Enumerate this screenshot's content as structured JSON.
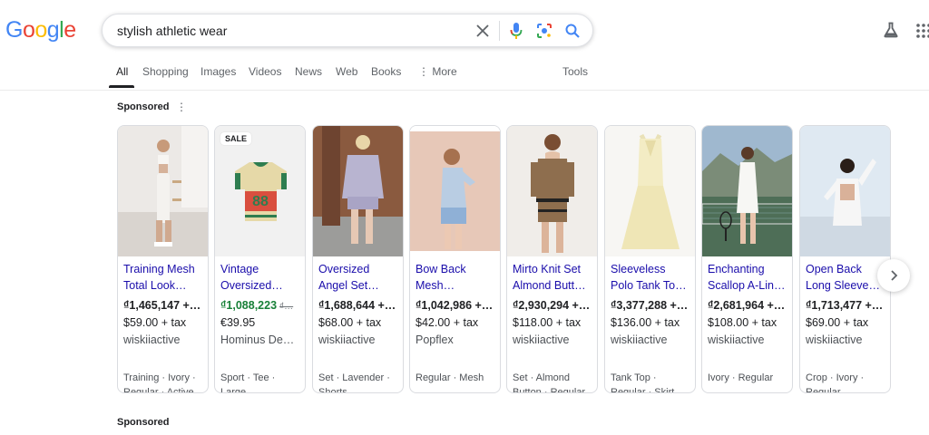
{
  "logo": {
    "letters": [
      "G",
      "o",
      "o",
      "g",
      "l",
      "e"
    ],
    "colors": [
      "#4285F4",
      "#EA4335",
      "#FBBC05",
      "#4285F4",
      "#34A853",
      "#EA4335"
    ]
  },
  "search": {
    "query": "stylish athletic wear"
  },
  "tabs": [
    "All",
    "Shopping",
    "Images",
    "Videos",
    "News",
    "Web",
    "Books",
    "More",
    "Tools"
  ],
  "sponsored": {
    "label": "Sponsored",
    "label_2": "Sponsored"
  },
  "products": [
    {
      "title_1": "Training Mesh",
      "title_2": "Total Look…",
      "price": "₫1,465,147 +…",
      "usd": "$59.00 + tax",
      "seller": "wiskiiactive",
      "tags_1": "Training · Ivory ·",
      "tags_2": "Regular · Active"
    },
    {
      "title_1": "Vintage",
      "title_2": "Oversized…",
      "price": "₫1,088,223",
      "orig_price": "₫…",
      "usd": "€39.95",
      "seller": "Hominus De…",
      "tags_1": "Sport · Tee ·",
      "tags_2": "Large",
      "badge": "SALE"
    },
    {
      "title_1": "Oversized",
      "title_2": "Angel Set…",
      "price": "₫1,688,644 +…",
      "usd": "$68.00 + tax",
      "seller": "wiskiiactive",
      "tags_1": "Set · Lavender ·",
      "tags_2": "Shorts"
    },
    {
      "title_1": "Bow Back",
      "title_2": "Mesh…",
      "price": "₫1,042,986 +…",
      "usd": "$42.00 + tax",
      "seller": "Popflex",
      "tags_1": "Regular · Mesh",
      "tags_2": ""
    },
    {
      "title_1": "Mirto Knit Set",
      "title_2": "Almond Butt…",
      "price": "₫2,930,294 +…",
      "usd": "$118.00 + tax",
      "seller": "wiskiiactive",
      "tags_1": "Set · Almond",
      "tags_2": "Button · Regular"
    },
    {
      "title_1": "Sleeveless",
      "title_2": "Polo Tank To…",
      "price": "₫3,377,288 +…",
      "usd": "$136.00 + tax",
      "seller": "wiskiiactive",
      "tags_1": "Tank Top ·",
      "tags_2": "Regular · Skirt"
    },
    {
      "title_1": "Enchanting",
      "title_2": "Scallop A-Lin…",
      "price": "₫2,681,964 +…",
      "usd": "$108.00 + tax",
      "seller": "wiskiiactive",
      "tags_1": "Ivory · Regular",
      "tags_2": ""
    },
    {
      "title_1": "Open Back",
      "title_2": "Long Sleeve…",
      "price": "₫1,713,477 +…",
      "usd": "$69.00 + tax",
      "seller": "wiskiiactive",
      "tags_1": "Crop · Ivory ·",
      "tags_2": "Regular"
    }
  ]
}
